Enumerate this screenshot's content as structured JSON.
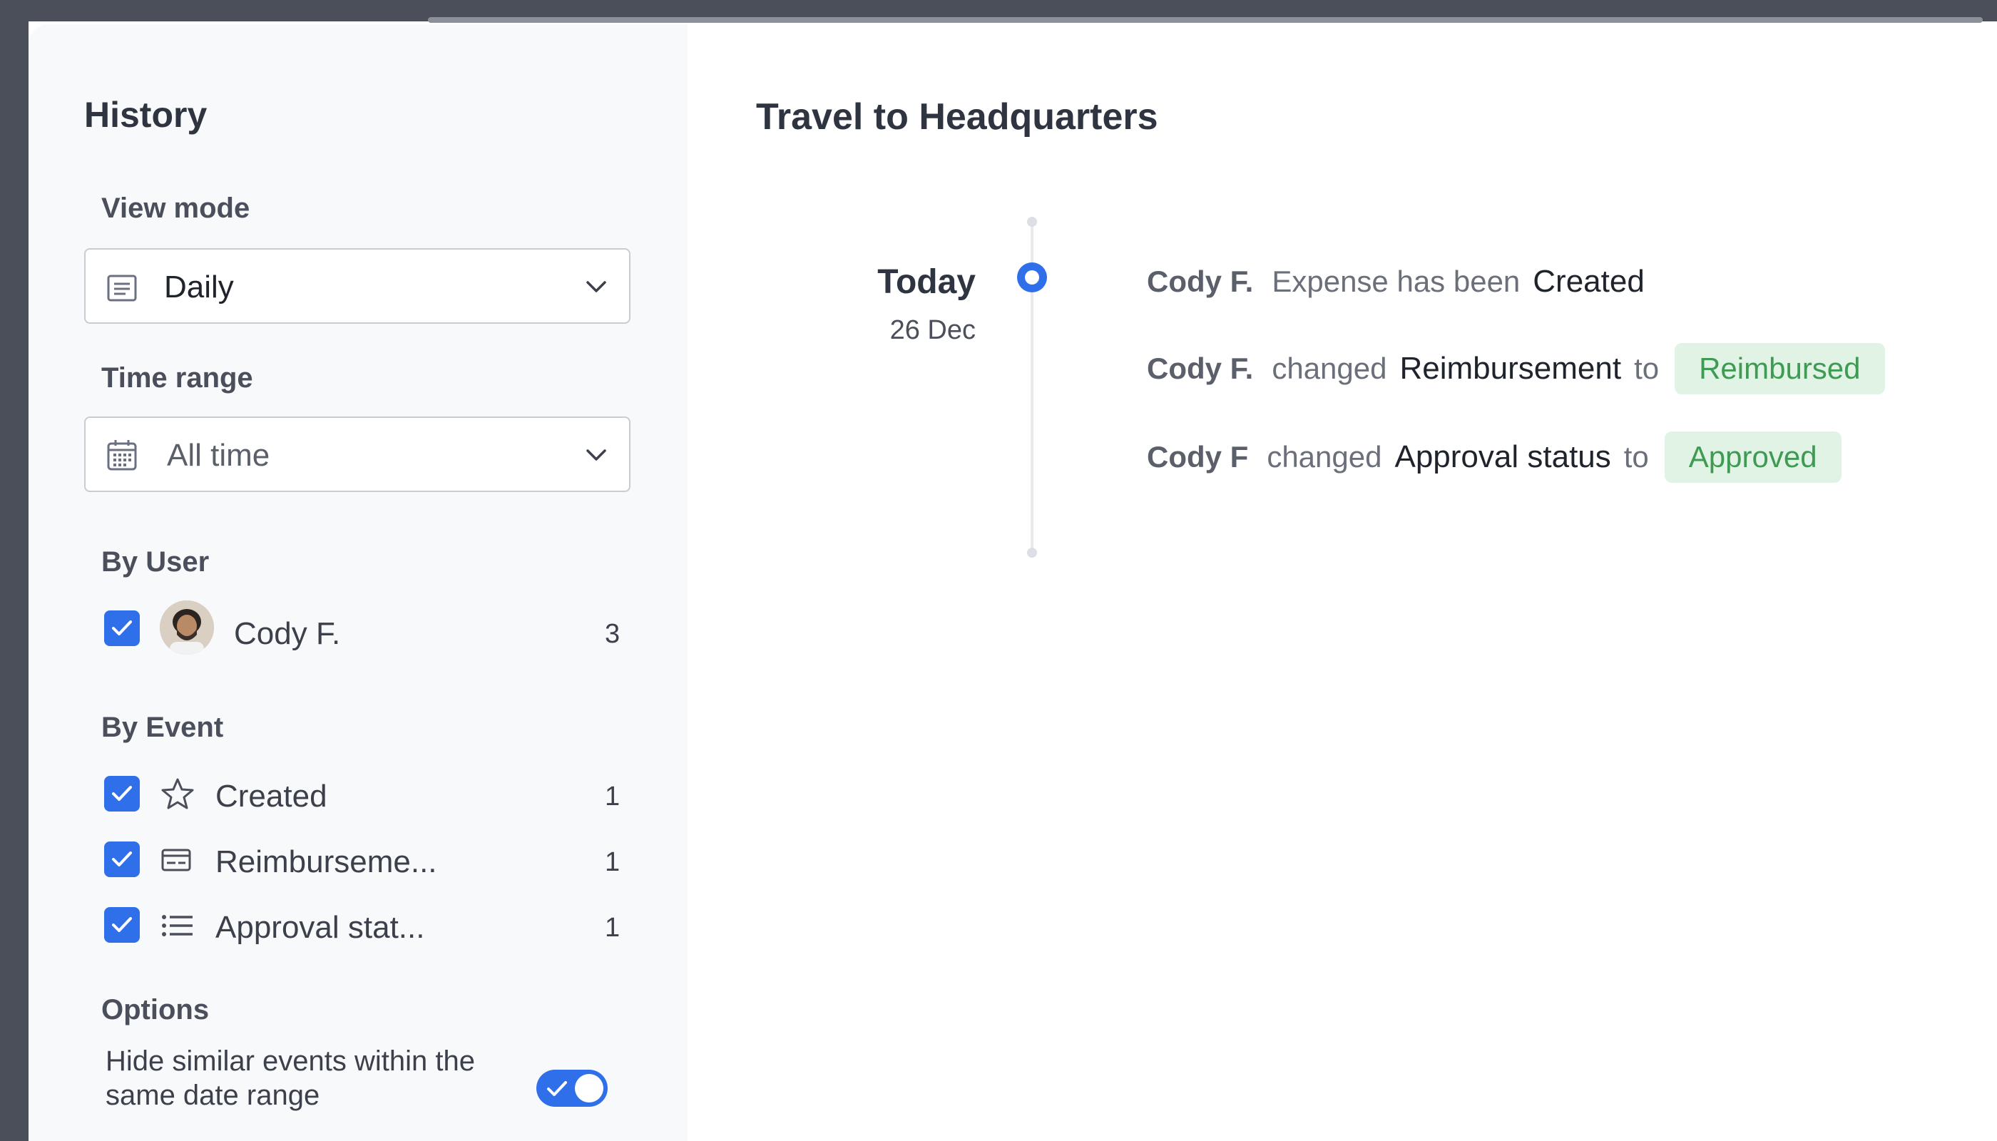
{
  "sidebar": {
    "title": "History",
    "view_mode": {
      "label": "View mode",
      "value": "Daily"
    },
    "time_range": {
      "label": "Time range",
      "value": "All time"
    },
    "by_user": {
      "label": "By User",
      "users": [
        {
          "name": "Cody F.",
          "count": "3"
        }
      ]
    },
    "by_event": {
      "label": "By Event",
      "events": [
        {
          "name": "Created",
          "count": "1",
          "icon": "star-icon"
        },
        {
          "name": "Reimburseme...",
          "count": "1",
          "icon": "card-icon"
        },
        {
          "name": "Approval stat...",
          "count": "1",
          "icon": "list-icon"
        }
      ]
    },
    "options": {
      "label": "Options",
      "hide_similar_text": "Hide similar events within the same date range",
      "hide_similar_enabled": true
    }
  },
  "main": {
    "title": "Travel to Headquarters",
    "timeline": {
      "day": "Today",
      "date": "26 Dec",
      "events": [
        {
          "user": "Cody F.",
          "verb": "Expense has been",
          "field": "Created",
          "to": "",
          "badge": ""
        },
        {
          "user": "Cody F.",
          "verb": "changed",
          "field": "Reimbursement",
          "to": "to",
          "badge": "Reimbursed"
        },
        {
          "user": "Cody F",
          "verb": "changed",
          "field": "Approval status",
          "to": "to",
          "badge": "Approved"
        }
      ]
    }
  },
  "colors": {
    "accent": "#2f6fea",
    "badge_bg": "#e0f3e4",
    "badge_text": "#3f9a53",
    "sidebar_bg": "#f8f9fb"
  }
}
